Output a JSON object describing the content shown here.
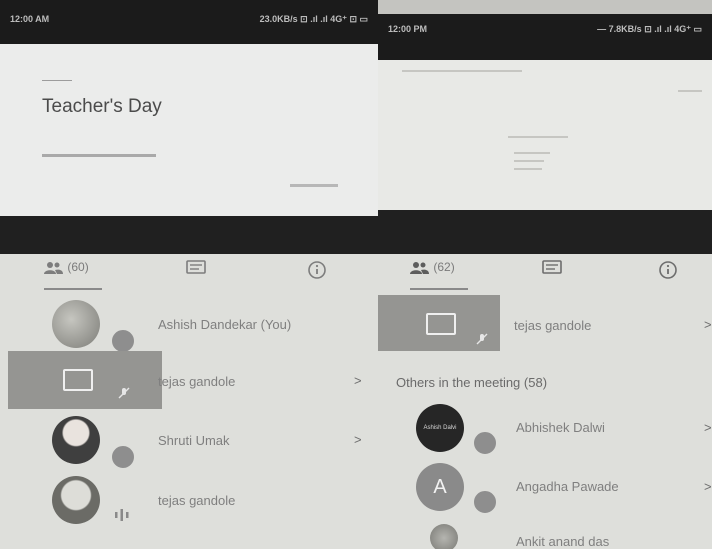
{
  "left": {
    "status_time": "12:00 AM",
    "status_icons": "23.0KB/s ⊡ .ıl .ıl 4G⁺ ⊡ ▭",
    "slide_title": "Teacher's Day",
    "tabs": {
      "people_count": "(60)"
    },
    "participants": [
      {
        "name": "Ashish Dandekar (You)"
      },
      {
        "name": "tejas gandole"
      },
      {
        "name": "Shruti Umak"
      },
      {
        "name": "tejas gandole"
      }
    ]
  },
  "right": {
    "status_time": "12:00 PM",
    "status_icons": "— 7.8KB/s ⊡ .ıl .ıl 4G⁺ ▭",
    "tabs": {
      "people_count": "(62)"
    },
    "presenter": {
      "name": "tejas gandole"
    },
    "others_label": "Others in the meeting (58)",
    "participants": [
      {
        "name": "Abhishek Dalwi",
        "avatar_text": "Ashish Dalvi"
      },
      {
        "name": "Angadha Pawade",
        "avatar_letter": "A"
      },
      {
        "name": "Ankit anand das"
      }
    ]
  },
  "icons": [
    "people-icon",
    "chat-icon",
    "info-icon",
    "present-screen-icon",
    "mic-muted-icon",
    "mic-active-icon",
    "chevron-right-icon"
  ]
}
